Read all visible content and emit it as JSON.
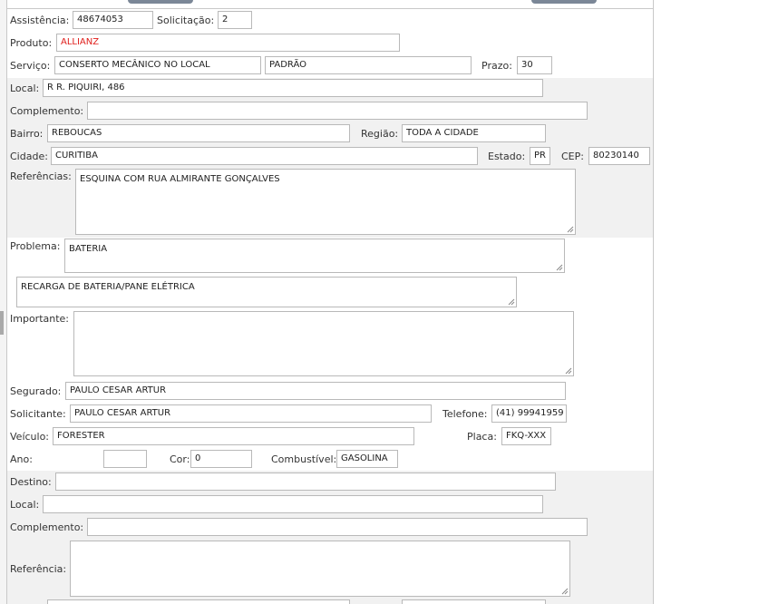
{
  "service": {
    "assistencia_label": "Assistência:",
    "assistencia_value": "48674053",
    "solicitacao_label": "Solicitação:",
    "solicitacao_value": "2",
    "produto_label": "Produto:",
    "produto_value": "ALLIANZ",
    "servico_label": "Serviço:",
    "servico_value": "CONSERTO MECÂNICO NO LOCAL",
    "servico_tipo_value": "PADRÃO",
    "prazo_label": "Prazo:",
    "prazo_value": "30"
  },
  "location": {
    "local_label": "Local:",
    "local_value": "R R. PIQUIRI, 486",
    "complemento_label": "Complemento:",
    "complemento_value": "",
    "bairro_label": "Bairro:",
    "bairro_value": "REBOUCAS",
    "regiao_label": "Região:",
    "regiao_value": "TODA A CIDADE",
    "cidade_label": "Cidade:",
    "cidade_value": "CURITIBA",
    "estado_label": "Estado:",
    "estado_value": "PR",
    "cep_label": "CEP:",
    "cep_value": "80230140",
    "referencias_label": "Referências:",
    "referencias_value": "ESQUINA COM RUA ALMIRANTE GONÇALVES"
  },
  "problem": {
    "problema_label": "Problema:",
    "problema_value": "BATERIA",
    "detalhe_value": "RECARGA DE BATERIA/PANE ELÉTRICA",
    "importante_label": "Importante:",
    "importante_value": ""
  },
  "insured": {
    "segurado_label": "Segurado:",
    "segurado_value": "PAULO CESAR ARTUR",
    "solicitante_label": "Solicitante:",
    "solicitante_value": "PAULO CESAR ARTUR",
    "telefone_label": "Telefone:",
    "telefone_value": "(41) 99941959",
    "veiculo_label": "Veículo:",
    "veiculo_value": "FORESTER",
    "placa_label": "Placa:",
    "placa_value": "FKQ-XXX",
    "ano_label": "Ano:",
    "ano_value": "",
    "cor_label": "Cor:",
    "cor_value": "0",
    "combustivel_label": "Combustível:",
    "combustivel_value": "GASOLINA"
  },
  "destination": {
    "destino_label": "Destino:",
    "destino_value": "",
    "local_label": "Local:",
    "local_value": "",
    "complemento_label": "Complemento:",
    "complemento_value": "",
    "referencia_label": "Referência:",
    "referencia_value": ""
  },
  "colors": {
    "produto_text": "#e0201d",
    "band_background": "#f1f1f1",
    "field_border": "#b9b9b9"
  }
}
